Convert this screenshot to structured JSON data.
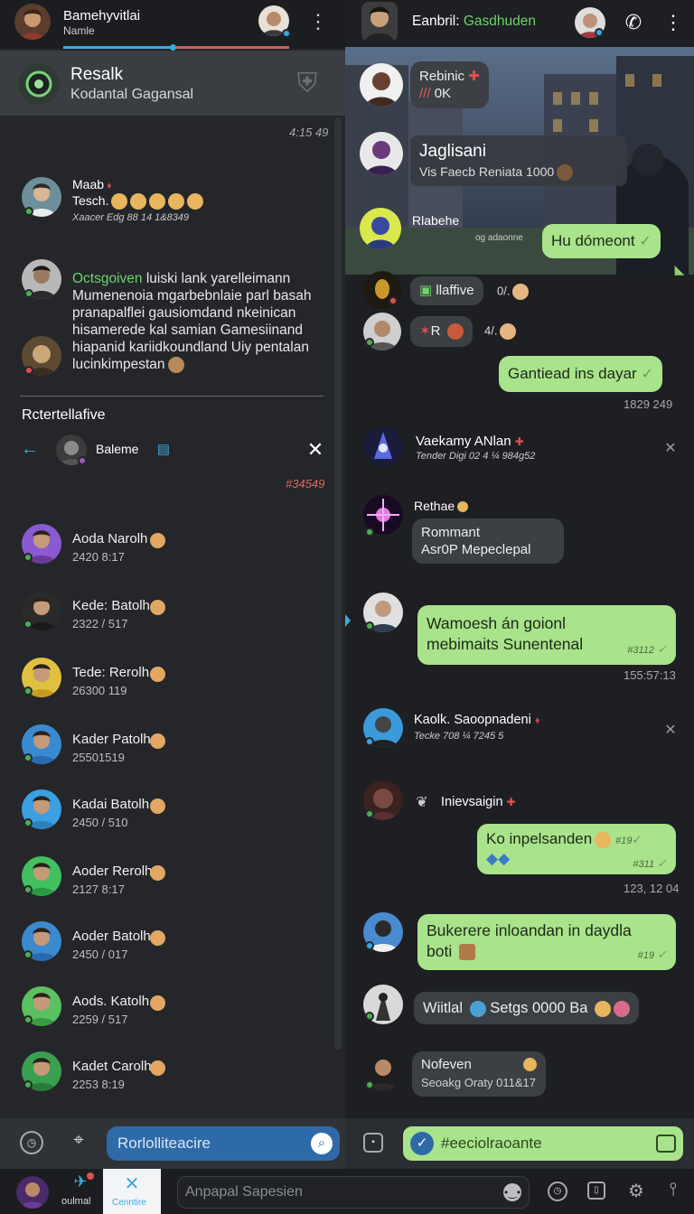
{
  "left_header": {
    "title": "Bamehyvitlai",
    "subtitle": "Namle"
  },
  "pinned": {
    "title": "Resalk",
    "subtitle": "Kodantal Gagansal",
    "time": "4:15 49"
  },
  "chat_preview": {
    "name": "Maab",
    "line": "Tesch.",
    "sub": "Xaacer Edg 88 14 1&8349"
  },
  "message_block": {
    "highlight": "Octsgoiven",
    "lines": [
      "Octsgoiven luiski lank yarelleimann",
      "Mumenenoia mgarbebnlaie parl basah",
      "pranapalflei gausiomdand nkeinican",
      "hisamerede kal samian Gamesiinand",
      "hiapanid kariidkoundland Uiy pentalan",
      "lucinkimpestan"
    ]
  },
  "section_title": "Rctertellafive",
  "subheader": {
    "name": "Baleme",
    "time": "#34549"
  },
  "contacts": [
    {
      "name": "Aoda Narolh",
      "num": "2420 8:17"
    },
    {
      "name": "Kede: Batolh",
      "num": "2322 / 517"
    },
    {
      "name": "Tede: Rerolh",
      "num": "26300 119"
    },
    {
      "name": "Kader Patolh",
      "num": "25501519"
    },
    {
      "name": "Kadai Batolh",
      "num": "2450 / 510"
    },
    {
      "name": "Aoder Rerolh",
      "num": "2127 8:17"
    },
    {
      "name": "Aoder Batolh",
      "num": "2450 / 017"
    },
    {
      "name": "Aods. Katolh",
      "num": "2259 / 517"
    },
    {
      "name": "Kadet Carolh",
      "num": "2253 8:19"
    }
  ],
  "right_header": {
    "label": "Eanbril:",
    "name": "Gasdhuden"
  },
  "right": {
    "m1": {
      "name": "Rebinic",
      "text": "/// 0K"
    },
    "m2": {
      "name": "Jaglisani",
      "text": "Vis Faecb Reniata 1000"
    },
    "m3": {
      "name": "Rlabehe",
      "small": "og adaonne",
      "bubble": "Hu dómeont"
    },
    "m4": {
      "text": "llaffive",
      "extra": "0/."
    },
    "m5": {
      "text": "R",
      "extra": "4/."
    },
    "m6": {
      "bubble": "Gantiead ins dayar",
      "time": "1829 249"
    },
    "m7": {
      "name": "Vaekamy ANlan",
      "sub": "Tender Digi 02 4 ¼ 984g52"
    },
    "m8": {
      "name": "Rethae",
      "bubble_l1": "Rommant",
      "bubble_l2": "Asr0P Mepeclepal"
    },
    "m9": {
      "l1": "Wamoesh án goionl",
      "l2": "mebimaits Sunentenal",
      "tick": "#3112",
      "time": "155:57:13"
    },
    "m10": {
      "name": "Kaolk. Saoopnadeni",
      "sub": "Tecke 708 ¼ 7245 5"
    },
    "m11": {
      "name": "Inievsaigin"
    },
    "m12": {
      "l1": "Ko inpelsanden",
      "tick1": "#19",
      "tick2": "#311",
      "time": "123, 12 04"
    },
    "m13": {
      "l1": "Bukerere inloandan in daydla",
      "l2": "boti",
      "tick": "#19"
    },
    "m14": {
      "text": "Wiitlal",
      "text2": "Setgs 0000 Ba"
    },
    "m15": {
      "l1": "Nofeven",
      "l2": "Seoakg Oraty 011&17"
    }
  },
  "bottom": {
    "left_search": "Rorlolliteacire",
    "right_input": "#eeciolraoante",
    "tab1": "oulmal",
    "tab2": "Cenntire",
    "compose": "Anpapal Sapesien"
  },
  "colors": {
    "accent_green": "#a9e38b",
    "accent_blue": "#3d7cc2",
    "link_green": "#6fd16a",
    "red": "#e05050"
  }
}
